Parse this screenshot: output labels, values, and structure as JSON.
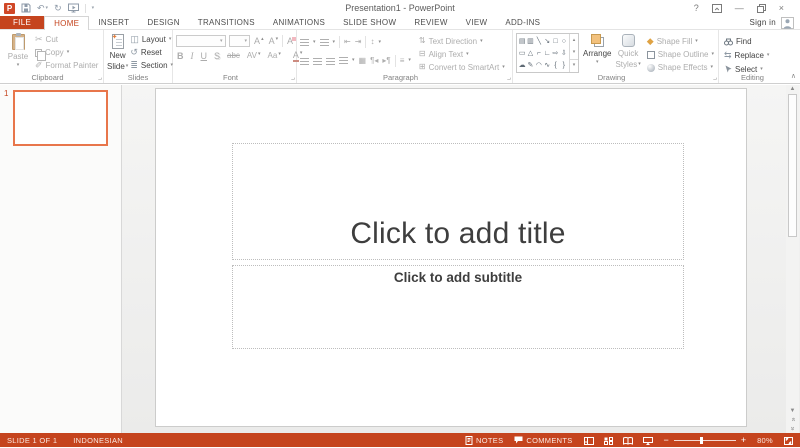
{
  "colors": {
    "accent": "#C5441E"
  },
  "titlebar": {
    "title": "Presentation1 - PowerPoint",
    "sign_in": "Sign in"
  },
  "icons": {
    "logo": "P",
    "undo": "↶",
    "redo": "↻",
    "qat_caret": "▾",
    "help": "?",
    "minimize": "—",
    "close": "×",
    "cut": "✂",
    "format_painter": "✐",
    "layout": "◫",
    "reset": "↺",
    "section": "≣",
    "grow_font": "A",
    "shrink_font": "A",
    "clear_formatting": "A",
    "indent_decrease": "⇤",
    "indent_increase": "⇥",
    "line_spacing": "↕",
    "distribute": "▦",
    "ltr": "¶◂",
    "rtl": "▸¶",
    "columns": "≡",
    "text_direction": "⇅",
    "align_text": "⊟",
    "smartart": "⊞",
    "caret": "▾",
    "up_small": "▴",
    "down_small": "▾",
    "scroll_up": "▲",
    "scroll_down": "▼",
    "chevrons": "«",
    "replace": "⇆",
    "shape_fill": "◆",
    "collapse": "∧",
    "launcher": "⌐",
    "shapes": [
      "▤",
      "▥",
      "╲",
      "↘",
      "□",
      "○",
      "▭",
      "△",
      "⌐",
      "∟",
      "⇨",
      "⇩",
      "☁",
      "✎",
      "◠",
      "∿",
      "{",
      "}"
    ]
  },
  "tabs": {
    "file": "FILE",
    "items": [
      "HOME",
      "INSERT",
      "DESIGN",
      "TRANSITIONS",
      "ANIMATIONS",
      "SLIDE SHOW",
      "REVIEW",
      "VIEW",
      "ADD-INS"
    ]
  },
  "ribbon": {
    "clipboard": {
      "label": "Clipboard",
      "paste": "Paste",
      "cut": "Cut",
      "copy": "Copy",
      "format_painter": "Format Painter"
    },
    "slides": {
      "label": "Slides",
      "new_line1": "New",
      "new_line2": "Slide",
      "layout": "Layout",
      "reset": "Reset",
      "section": "Section"
    },
    "font": {
      "label": "Font",
      "bold": "B",
      "italic": "I",
      "underline": "U",
      "shadow": "S",
      "strikethrough": "abc",
      "char_spacing": "AV",
      "change_case": "Aa",
      "font_color": "A"
    },
    "paragraph": {
      "label": "Paragraph",
      "text_direction": "Text Direction",
      "align_text": "Align Text",
      "smartart": "Convert to SmartArt"
    },
    "drawing": {
      "label": "Drawing",
      "arrange": "Arrange",
      "quick_line1": "Quick",
      "quick_line2": "Styles",
      "shape_fill": "Shape Fill",
      "shape_outline": "Shape Outline",
      "shape_effects": "Shape Effects"
    },
    "editing": {
      "label": "Editing",
      "find": "Find",
      "replace": "Replace",
      "select": "Select"
    }
  },
  "slide_panel": {
    "number": "1"
  },
  "slide": {
    "title_prompt": "Click to add title",
    "subtitle_prompt": "Click to add subtitle"
  },
  "statusbar": {
    "slide_info": "SLIDE 1 OF 1",
    "language": "INDONESIAN",
    "notes": "NOTES",
    "comments": "COMMENTS",
    "zoom_out": "−",
    "zoom_in": "+",
    "zoom_level": "80%"
  }
}
